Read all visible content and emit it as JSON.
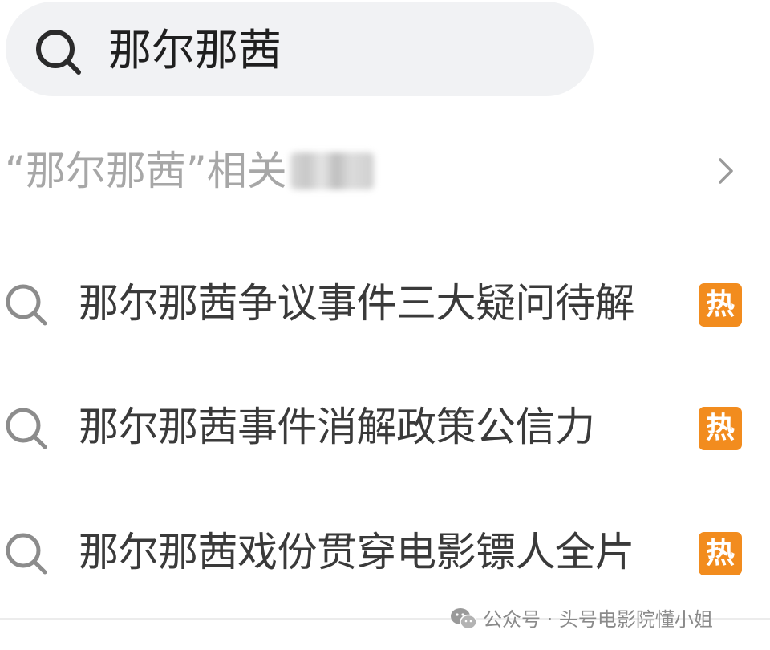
{
  "search": {
    "query": "那尔那茜",
    "icon": "search-icon"
  },
  "related": {
    "text": "“那尔那茜”相关",
    "icon": "chevron-right-icon"
  },
  "suggestions": [
    {
      "text": "那尔那茜争议事件三大疑问待解",
      "badge": "热"
    },
    {
      "text": "那尔那茜事件消解政策公信力",
      "badge": "热"
    },
    {
      "text": "那尔那茜戏份贯穿电影镖人全片",
      "badge": "热"
    }
  ],
  "watermark": {
    "text": "公众号 · 头号电影院懂小姐",
    "icon": "wechat-icon"
  },
  "colors": {
    "search_bg": "#f1f2f4",
    "hot_badge": "#f28c1e",
    "suggestion_text": "#3a3a3a",
    "related_text": "#a7a7a7"
  }
}
